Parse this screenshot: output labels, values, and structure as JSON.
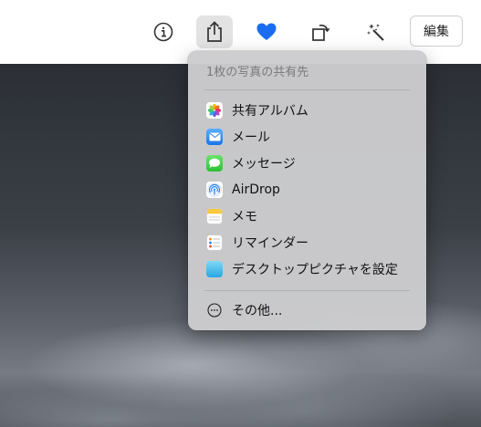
{
  "toolbar": {
    "edit_label": "編集",
    "icons": [
      "info-icon",
      "share-icon",
      "heart-icon",
      "rotate-icon",
      "magic-wand-icon"
    ],
    "favorite_color": "#1a6cf0"
  },
  "share_menu": {
    "header": "1枚の写真の共有先",
    "items": [
      {
        "label": "共有アルバム",
        "icon": "photos-icon"
      },
      {
        "label": "メール",
        "icon": "mail-icon"
      },
      {
        "label": "メッセージ",
        "icon": "messages-icon"
      },
      {
        "label": "AirDrop",
        "icon": "airdrop-icon"
      },
      {
        "label": "メモ",
        "icon": "notes-icon"
      },
      {
        "label": "リマインダー",
        "icon": "reminders-icon"
      },
      {
        "label": "デスクトップピクチャを設定",
        "icon": "desktop-picture-icon"
      }
    ],
    "more_label": "その他..."
  }
}
